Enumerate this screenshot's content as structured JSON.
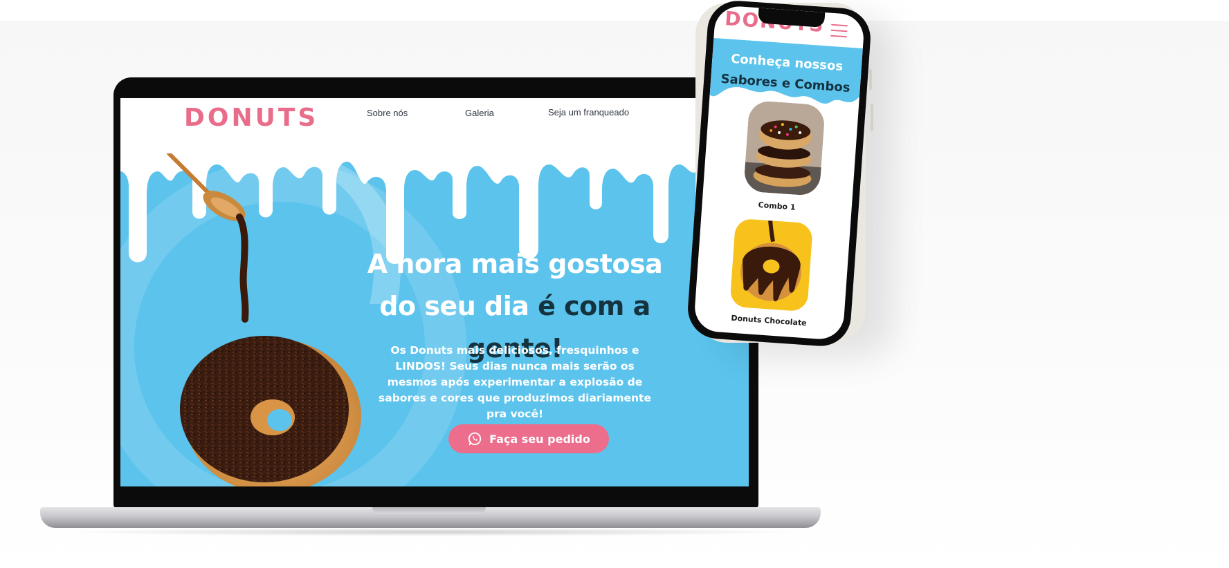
{
  "site": {
    "logo": "DONUTS",
    "nav": [
      "Sobre nós",
      "Galeria",
      "Seja um franqueado"
    ]
  },
  "hero": {
    "title_part1": "A hora mais gostosa do seu dia",
    "title_part2": "é com a gente!",
    "text": "Os Donuts mais deliciosos, fresquinhos  e LINDOS! Seus dias nunca mais serão os mesmos após experimentar a explosão de sabores e cores que produzimos diariamente pra você!",
    "cta_label": "Faça seu pedido",
    "cta_icon": "whatsapp-icon"
  },
  "mobile": {
    "logo": "DONUTS",
    "menu_icon": "hamburger-menu-icon",
    "heading_line1": "Conheça nossos",
    "heading_line2": "Sabores e Combos",
    "products": [
      {
        "label": "Combo 1"
      },
      {
        "label": "Donuts Chocolate"
      }
    ]
  },
  "colors": {
    "brand_pink": "#ec6e8c",
    "hero_blue": "#5bc3ec",
    "dark_text": "#15323f"
  }
}
